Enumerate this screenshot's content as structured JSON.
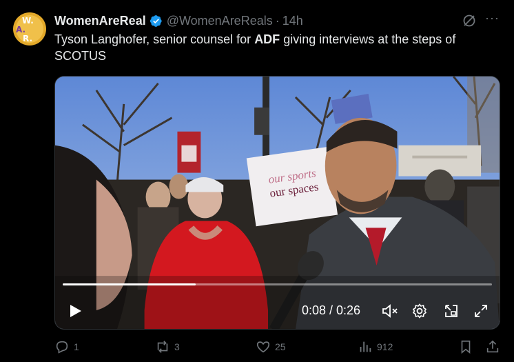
{
  "tweet": {
    "avatar_letters": [
      "W.",
      "A.",
      "R."
    ],
    "display_name": "WomenAreReal",
    "handle": "@WomenAreReals",
    "separator": "·",
    "time": "14h",
    "more_label": "···",
    "text_part1": "Tyson Langhofer, senior counsel for ",
    "text_bold": "ADF",
    "text_part2": " giving interviews at the steps of SCOTUS"
  },
  "video": {
    "time_display": "0:08 / 0:26",
    "progress": 0.31,
    "sign_text_line1": "our sports",
    "sign_text_line2": "our spaces"
  },
  "actions": {
    "replies": "1",
    "reposts": "3",
    "likes": "25",
    "views": "912"
  },
  "colors": {
    "background": "#000000",
    "text": "#e7e9ea",
    "muted": "#71767b",
    "verified": "#1d9bf0"
  }
}
